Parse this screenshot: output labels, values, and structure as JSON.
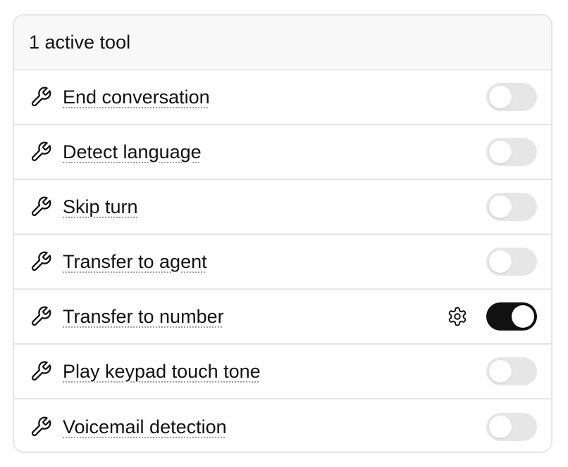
{
  "header": {
    "title": "1 active tool"
  },
  "tools": [
    {
      "label": "End conversation",
      "enabled": false,
      "has_settings": false
    },
    {
      "label": "Detect language",
      "enabled": false,
      "has_settings": false
    },
    {
      "label": "Skip turn",
      "enabled": false,
      "has_settings": false
    },
    {
      "label": "Transfer to agent",
      "enabled": false,
      "has_settings": false
    },
    {
      "label": "Transfer to number",
      "enabled": true,
      "has_settings": true
    },
    {
      "label": "Play keypad touch tone",
      "enabled": false,
      "has_settings": false
    },
    {
      "label": "Voicemail detection",
      "enabled": false,
      "has_settings": false
    }
  ],
  "icons": {
    "tool": "wrench-icon",
    "settings": "gear-icon"
  },
  "colors": {
    "toggle_on": "#111111",
    "toggle_off": "#e6e6e6",
    "header_bg": "#f8f8f8",
    "border": "#e5e5e5"
  }
}
